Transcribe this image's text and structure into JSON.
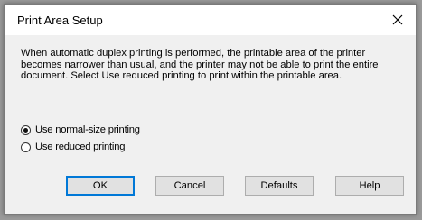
{
  "dialog": {
    "title": "Print Area Setup",
    "message": "When automatic duplex printing is performed, the printable area of the printer becomes narrower than usual, and the printer may not be able to print the entire document. Select Use reduced printing to print within the printable area.",
    "options": [
      {
        "label": "Use normal-size printing",
        "selected": true
      },
      {
        "label": "Use reduced printing",
        "selected": false
      }
    ],
    "buttons": {
      "ok": "OK",
      "cancel": "Cancel",
      "defaults": "Defaults",
      "help": "Help"
    }
  }
}
